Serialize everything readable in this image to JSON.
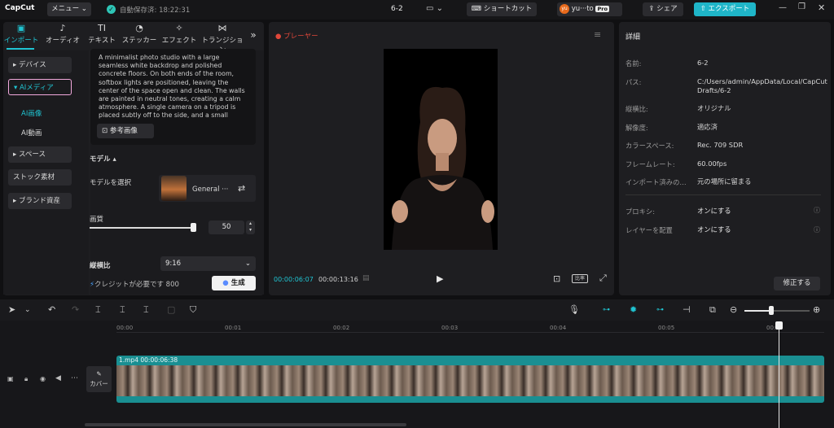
{
  "app": {
    "logo": "CapCut",
    "menu_label": "メニュー",
    "autosave": "自動保存済: 18:22:31",
    "project_title": "6-2",
    "shortcut_label": "ショートカット",
    "user_label": "yu···to",
    "user_avatar": "yu",
    "pro_badge": "Pro",
    "share_label": "シェア",
    "export_label": "エクスポート"
  },
  "media_tabs": [
    {
      "label": "インポート",
      "icon": "import-icon"
    },
    {
      "label": "オーディオ",
      "icon": "audio-icon"
    },
    {
      "label": "テキスト",
      "icon": "text-icon"
    },
    {
      "label": "ステッカー",
      "icon": "sticker-icon"
    },
    {
      "label": "エフェクト",
      "icon": "effect-icon"
    },
    {
      "label": "トランジション",
      "icon": "transition-icon"
    }
  ],
  "sidebar": {
    "device": "デバイス",
    "ai_media": "AIメディア",
    "ai_image": "AI画像",
    "ai_video": "AI動画",
    "space": "スペース",
    "stock": "ストック素材",
    "brand": "ブランド資産"
  },
  "ai_panel": {
    "description": "A minimalist photo studio with a large seamless white backdrop and polished concrete floors. On both ends of the room, softbox lights are positioned, leaving the center of the space open and clean. The walls are painted in neutral tones, creating a calm atmosphere. A single camera on a tripod is placed subtly off to the side, and a small",
    "reference_btn": "参考画像",
    "model_heading": "モデル",
    "model_select_label": "モデルを選択",
    "model_name": "General ···",
    "quality_label": "画質",
    "quality_value": "50",
    "quality_fraction": 0.5,
    "ratio_label": "縦横比",
    "ratio_value": "9:16",
    "credit_text": "クレジットが必要です 800",
    "generate_btn": "生成"
  },
  "player": {
    "title": "プレーヤー",
    "current_time": "00:00:06:07",
    "total_time": "00:00:13:16",
    "ratio_btn": "比率"
  },
  "details": {
    "title": "詳細",
    "rows": [
      {
        "label": "名前:",
        "value": "6-2"
      },
      {
        "label": "パス:",
        "value": "C:/Users/admin/AppData/Local/CapCut Drafts/6-2"
      },
      {
        "label": "縦横比:",
        "value": "オリジナル"
      },
      {
        "label": "解像度:",
        "value": "適応済"
      },
      {
        "label": "カラースペース:",
        "value": "Rec. 709 SDR"
      },
      {
        "label": "フレームレート:",
        "value": "60.00fps"
      },
      {
        "label": "インポート済みの…",
        "value": "元の場所に留まる"
      }
    ],
    "proxy_label": "プロキシ:",
    "proxy_value": "オンにする",
    "layer_label": "レイヤーを配置",
    "layer_value": "オンにする",
    "fix_btn": "修正する"
  },
  "timeline": {
    "ruler": [
      "00:00",
      "00:01",
      "00:02",
      "00:03",
      "00:04",
      "00:05",
      "00:06"
    ],
    "clip_label": "1.mp4  00:00:06:38",
    "cover_label": "カバー"
  }
}
